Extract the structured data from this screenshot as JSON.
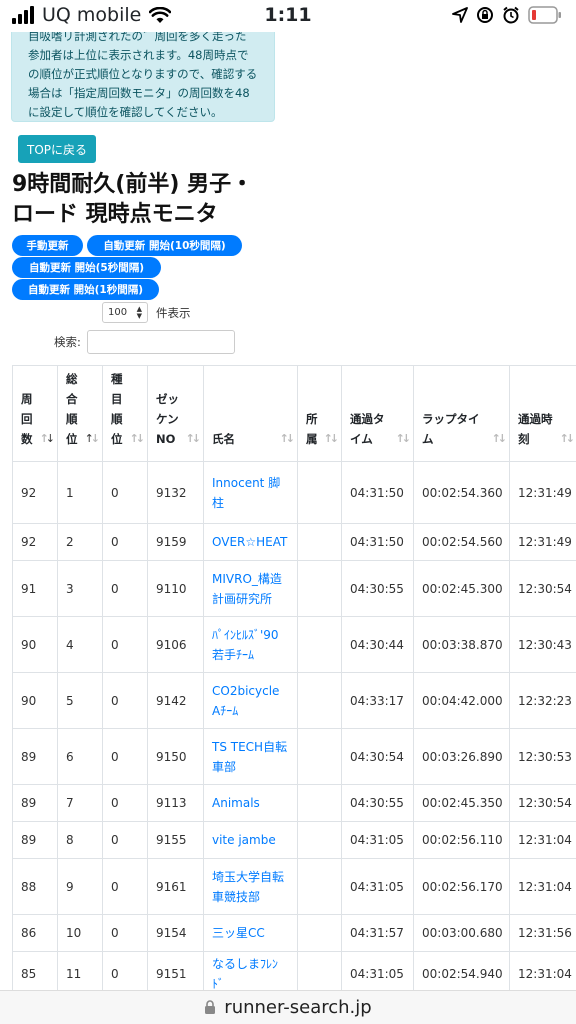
{
  "status": {
    "carrier": "UQ mobile",
    "time": "1:11"
  },
  "alert_lines": [
    "自吸嗜リ計測されたの゛周回を多く走った",
    "参加者は上位に表示されます。48周時点で",
    "の順位が正式順位となりますので、確認する",
    "場合は「指定周回数モニタ」の周回数を48",
    "に設定して順位を確認してください。"
  ],
  "top_button": "TOPに戻る",
  "title_lines": [
    "9時間耐久(前半) 男子・",
    "ロード 現時点モニタ"
  ],
  "buttons": {
    "manual": "手動更新",
    "auto10": "自動更新 開始(10秒間隔)",
    "auto5": "自動更新 開始(5秒間隔)",
    "auto1": "自動更新 開始(1秒間隔)"
  },
  "length": {
    "value": "100",
    "label": "件表示"
  },
  "search": {
    "label": "検索:",
    "placeholder": ""
  },
  "columns": [
    {
      "lines": [
        "周",
        "回",
        "数"
      ],
      "sort": "desc"
    },
    {
      "lines": [
        "総",
        "合",
        "順",
        "位"
      ],
      "sort": "asc"
    },
    {
      "lines": [
        "種",
        "目",
        "順",
        "位"
      ],
      "sort": "none"
    },
    {
      "lines": [
        "ゼッ",
        "ケン",
        "NO"
      ],
      "sort": "none"
    },
    {
      "lines": [
        "氏名"
      ],
      "sort": "none"
    },
    {
      "lines": [
        "所",
        "属"
      ],
      "sort": "none"
    },
    {
      "lines": [
        "通過タ",
        "イム"
      ],
      "sort": "none"
    },
    {
      "lines": [
        "ラップタイ",
        "ム"
      ],
      "sort": "none"
    },
    {
      "lines": [
        "通過時",
        "刻"
      ],
      "sort": "none"
    }
  ],
  "rows": [
    {
      "laps": "92",
      "rank": "1",
      "cat_rank": "0",
      "bib": "9132",
      "name": [
        "Innocent 脚",
        "柱"
      ],
      "team": "",
      "elapsed": "04:31:50",
      "lap": "00:02:54.360",
      "clock": "12:31:49"
    },
    {
      "laps": "92",
      "rank": "2",
      "cat_rank": "0",
      "bib": "9159",
      "name": [
        "OVER☆HEAT"
      ],
      "team": "",
      "elapsed": "04:31:50",
      "lap": "00:02:54.560",
      "clock": "12:31:49"
    },
    {
      "laps": "91",
      "rank": "3",
      "cat_rank": "0",
      "bib": "9110",
      "name": [
        "MIVRO_構造",
        "計画研究所"
      ],
      "team": "",
      "elapsed": "04:30:55",
      "lap": "00:02:45.300",
      "clock": "12:30:54"
    },
    {
      "laps": "90",
      "rank": "4",
      "cat_rank": "0",
      "bib": "9106",
      "name": [
        "ﾊﾟｲﾝﾋﾙｽﾞ'90",
        "若手ﾁｰﾑ"
      ],
      "team": "",
      "elapsed": "04:30:44",
      "lap": "00:03:38.870",
      "clock": "12:30:43"
    },
    {
      "laps": "90",
      "rank": "5",
      "cat_rank": "0",
      "bib": "9142",
      "name": [
        "CO2bicycle",
        "Aﾁｰﾑ"
      ],
      "team": "",
      "elapsed": "04:33:17",
      "lap": "00:04:42.000",
      "clock": "12:32:23"
    },
    {
      "laps": "89",
      "rank": "6",
      "cat_rank": "0",
      "bib": "9150",
      "name": [
        "TS TECH自転",
        "車部"
      ],
      "team": "",
      "elapsed": "04:30:54",
      "lap": "00:03:26.890",
      "clock": "12:30:53"
    },
    {
      "laps": "89",
      "rank": "7",
      "cat_rank": "0",
      "bib": "9113",
      "name": [
        "Animals"
      ],
      "team": "",
      "elapsed": "04:30:55",
      "lap": "00:02:45.350",
      "clock": "12:30:54"
    },
    {
      "laps": "89",
      "rank": "8",
      "cat_rank": "0",
      "bib": "9155",
      "name": [
        "vite jambe"
      ],
      "team": "",
      "elapsed": "04:31:05",
      "lap": "00:02:56.110",
      "clock": "12:31:04"
    },
    {
      "laps": "88",
      "rank": "9",
      "cat_rank": "0",
      "bib": "9161",
      "name": [
        "埼玉大学自転",
        "車競技部"
      ],
      "team": "",
      "elapsed": "04:31:05",
      "lap": "00:02:56.170",
      "clock": "12:31:04"
    },
    {
      "laps": "86",
      "rank": "10",
      "cat_rank": "0",
      "bib": "9154",
      "name": [
        "三ッ星CC"
      ],
      "team": "",
      "elapsed": "04:31:57",
      "lap": "00:03:00.680",
      "clock": "12:31:56"
    },
    {
      "laps": "85",
      "rank": "11",
      "cat_rank": "0",
      "bib": "9151",
      "name": [
        "なるしまﾌﾚﾝ",
        "ﾄﾞ"
      ],
      "team": "",
      "elapsed": "04:31:05",
      "lap": "00:02:54.940",
      "clock": "12:31:04"
    }
  ],
  "address": "runner-search.jp"
}
